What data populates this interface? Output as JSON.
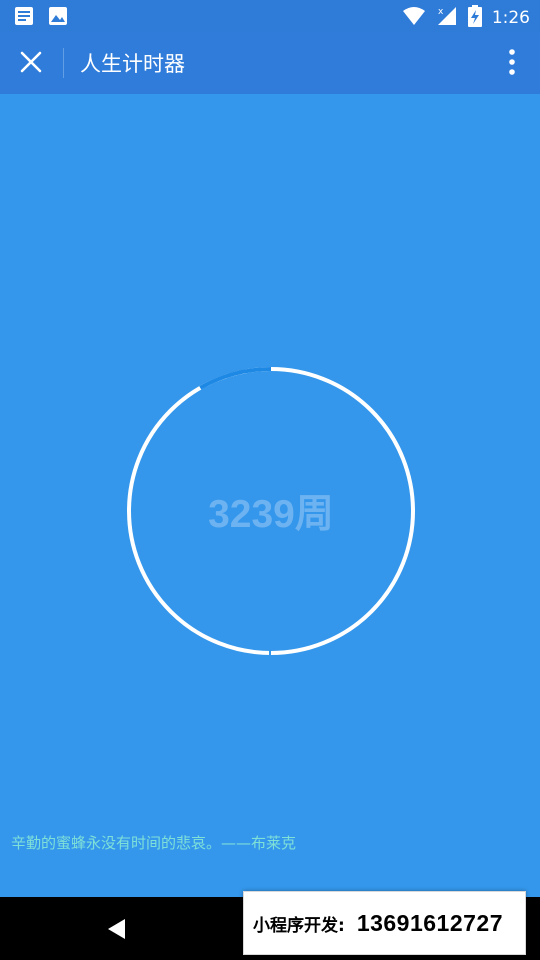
{
  "status_bar": {
    "time": "1:26",
    "icons": [
      "notification-message-icon",
      "notification-image-icon",
      "wifi-icon",
      "cellular-signal-icon",
      "battery-charging-icon"
    ]
  },
  "app_bar": {
    "title": "人生计时器",
    "close_icon": "close-icon",
    "more_icon": "more-vertical-icon"
  },
  "timer": {
    "label": "3239周",
    "progress_fraction": 0.917
  },
  "quote": "辛勤的蜜蜂永没有时间的悲哀。——布莱克",
  "nav_bar": {
    "back_icon": "back-triangle-icon"
  },
  "ad_banner": {
    "label": "小程序开发:",
    "phone": "13691612727"
  },
  "colors": {
    "status_bar": "#2E7BD8",
    "app_bar": "#2F7CDA",
    "background": "#3497EB",
    "ring_track": "#FFFFFF",
    "ring_elapsed": "#1E88E5",
    "label": "#6DB2F1",
    "quote": "#7FE0D8"
  }
}
